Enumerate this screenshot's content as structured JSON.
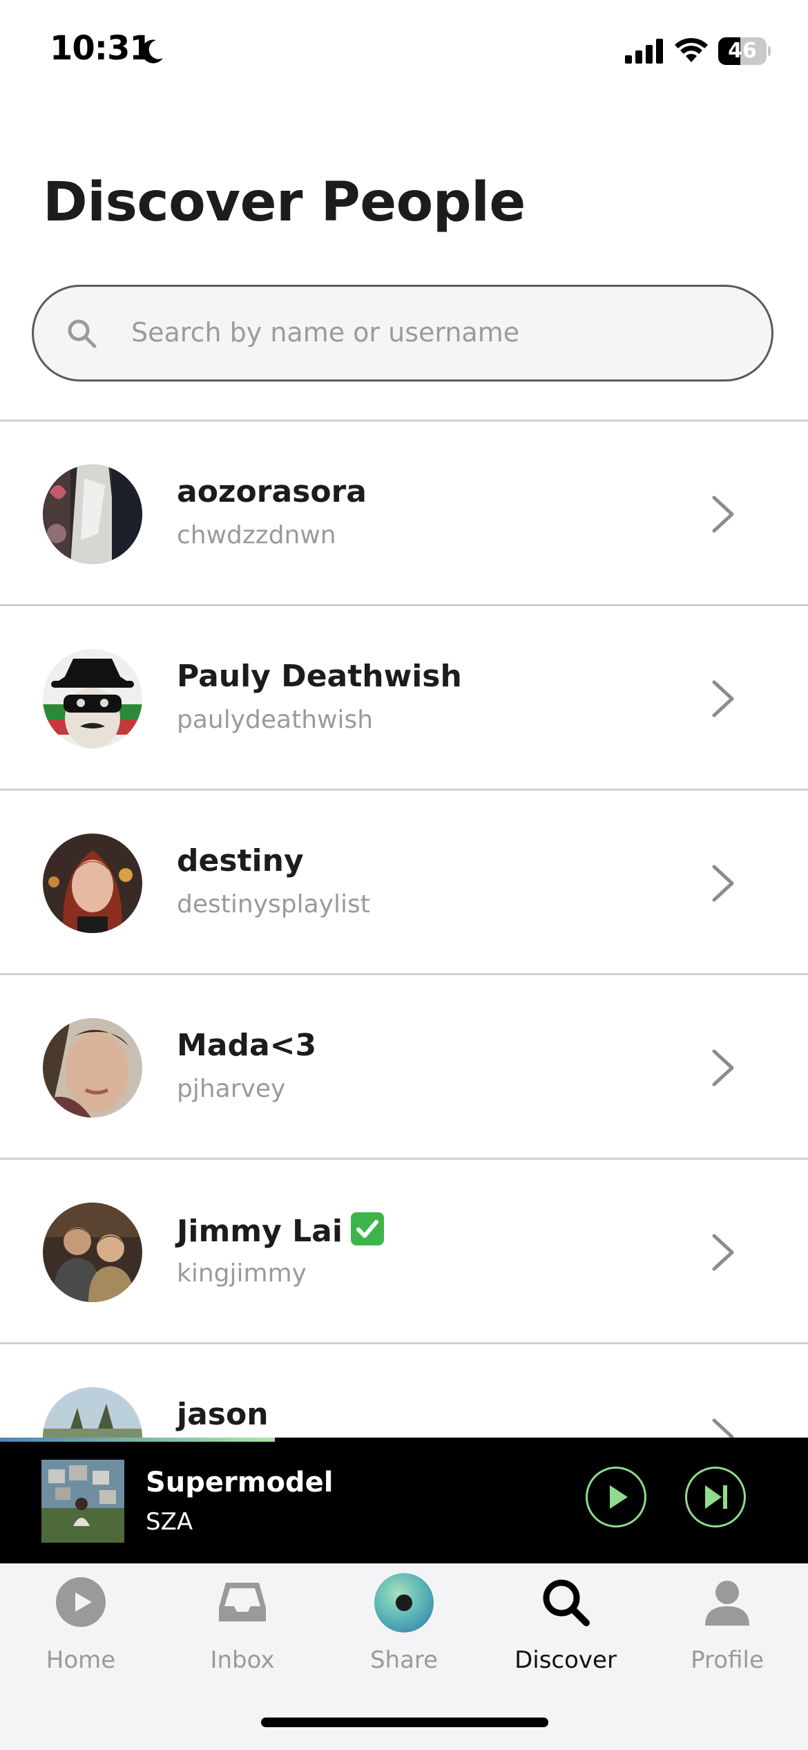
{
  "status_bar": {
    "time": "10:31",
    "battery": "46",
    "battery_level": 0.46
  },
  "page": {
    "title": "Discover People"
  },
  "search": {
    "placeholder": "Search by name or username"
  },
  "people": [
    {
      "name": "aozorasora",
      "username": "chwdzzdnwn",
      "verified": false
    },
    {
      "name": "Pauly Deathwish",
      "username": "paulydeathwish",
      "verified": false
    },
    {
      "name": "destiny",
      "username": "destinysplaylist",
      "verified": false
    },
    {
      "name": "Mada<3",
      "username": "pjharvey",
      "verified": false
    },
    {
      "name": "Jimmy Lai",
      "username": "kingjimmy",
      "verified": true
    },
    {
      "name": "jason",
      "username": "",
      "verified": false
    }
  ],
  "player": {
    "title": "Supermodel",
    "artist": "SZA",
    "progress": 0.34
  },
  "tabs": [
    {
      "label": "Home",
      "icon": "play-circle-icon",
      "active": false
    },
    {
      "label": "Inbox",
      "icon": "inbox-tray-icon",
      "active": false
    },
    {
      "label": "Share",
      "icon": "share-orb-icon",
      "active": false
    },
    {
      "label": "Discover",
      "icon": "search-icon",
      "active": true
    },
    {
      "label": "Profile",
      "icon": "person-icon",
      "active": false
    }
  ],
  "colors": {
    "accent_green": "#8fdc8f",
    "player_bg": "#000000",
    "tab_bar_bg": "#f4f4f6"
  }
}
